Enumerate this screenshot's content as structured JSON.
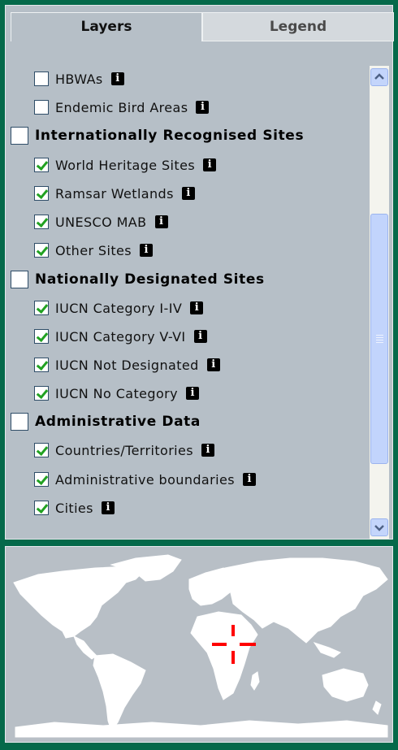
{
  "tabs": [
    {
      "label": "Layers",
      "active": true
    },
    {
      "label": "Legend",
      "active": false
    }
  ],
  "layers": [
    {
      "label": "HBWAs",
      "checked": false,
      "group": false,
      "info": true
    },
    {
      "label": "Endemic Bird Areas",
      "checked": false,
      "group": false,
      "info": true
    },
    {
      "label": "Internationally Recognised Sites",
      "checked": false,
      "group": true,
      "info": false
    },
    {
      "label": "World Heritage Sites",
      "checked": true,
      "group": false,
      "info": true
    },
    {
      "label": "Ramsar Wetlands",
      "checked": true,
      "group": false,
      "info": true
    },
    {
      "label": "UNESCO MAB",
      "checked": true,
      "group": false,
      "info": true
    },
    {
      "label": "Other Sites",
      "checked": true,
      "group": false,
      "info": true
    },
    {
      "label": "Nationally Designated Sites",
      "checked": false,
      "group": true,
      "info": false
    },
    {
      "label": "IUCN Category I-IV",
      "checked": true,
      "group": false,
      "info": true
    },
    {
      "label": "IUCN Category V-VI",
      "checked": true,
      "group": false,
      "info": true
    },
    {
      "label": "IUCN Not Designated",
      "checked": true,
      "group": false,
      "info": true
    },
    {
      "label": "IUCN No Category",
      "checked": true,
      "group": false,
      "info": true
    },
    {
      "label": "Administrative Data",
      "checked": false,
      "group": true,
      "info": false
    },
    {
      "label": "Countries/Territories",
      "checked": true,
      "group": false,
      "info": true
    },
    {
      "label": "Administrative boundaries",
      "checked": true,
      "group": false,
      "info": true
    },
    {
      "label": "Cities",
      "checked": true,
      "group": false,
      "info": true
    }
  ],
  "info_icon_glyph": "i",
  "colors": {
    "background": "#05694a",
    "panel": "#b6bfc7",
    "check": "#21a121",
    "map_land": "#ffffff",
    "map_marker": "#ff0000"
  }
}
